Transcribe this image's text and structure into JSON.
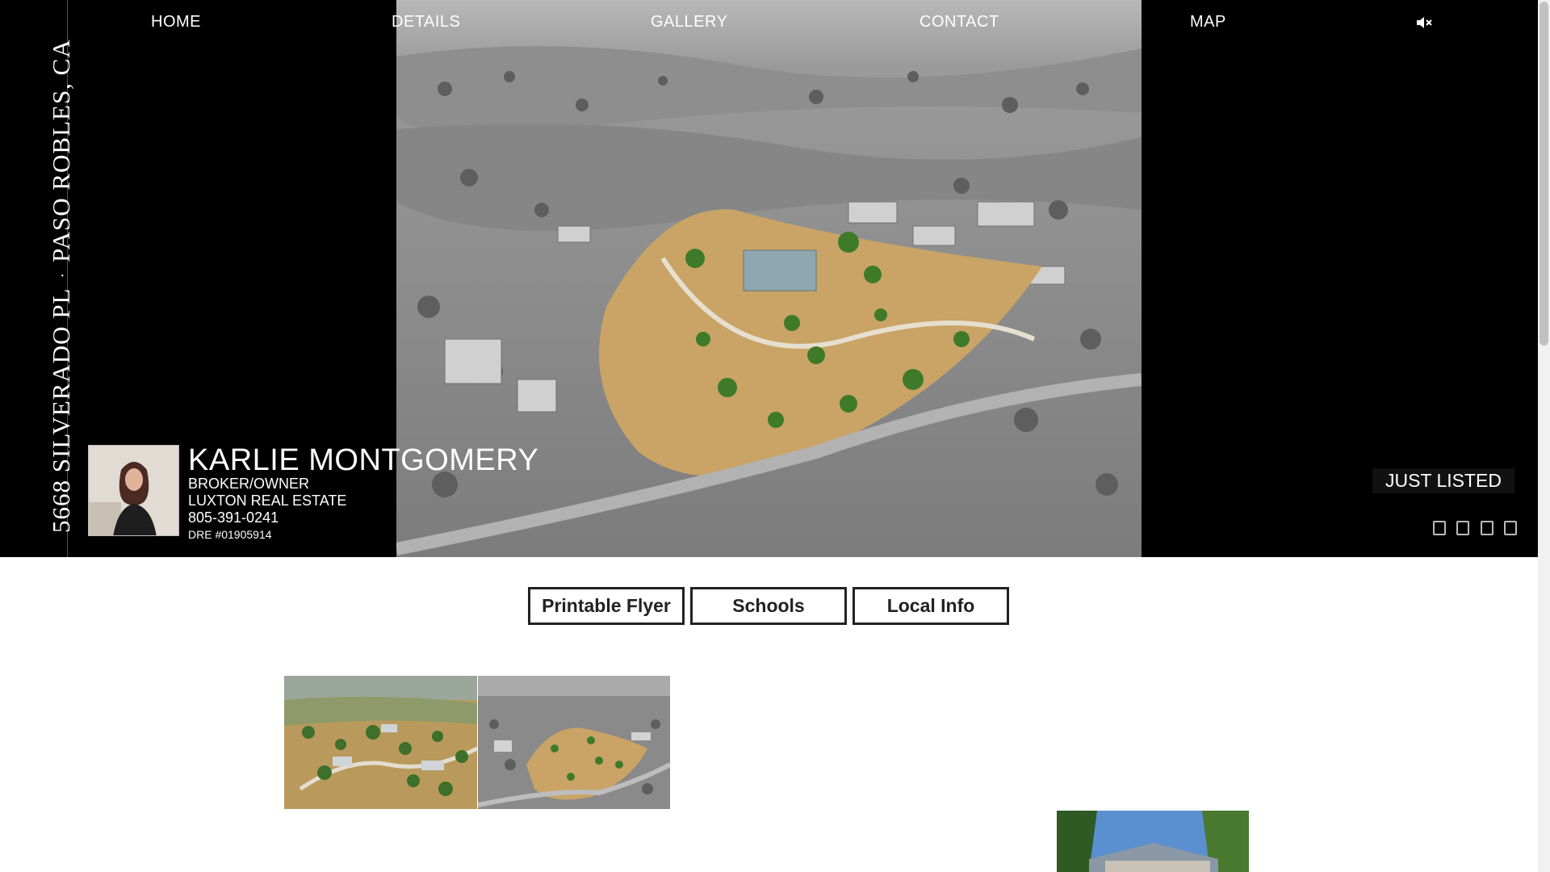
{
  "nav": {
    "items": [
      "HOME",
      "DETAILS",
      "GALLERY",
      "CONTACT",
      "MAP"
    ],
    "mute_icon": "volume-mute-icon"
  },
  "sidebar": {
    "street": "5668 SILVERADO PL",
    "separator": "·",
    "city": "PASO ROBLES, CA"
  },
  "agent": {
    "name": "KARLIE MONTGOMERY",
    "title": "BROKER/OWNER",
    "brokerage": "LUXTON REAL ESTATE",
    "phone": "805-391-0241",
    "dre": "DRE #01905914"
  },
  "status_badge": "JUST LISTED",
  "social_icons": [
    "facebook-icon",
    "twitter-icon",
    "pinterest-icon",
    "email-icon"
  ],
  "buttons": {
    "flyer": "Printable Flyer",
    "schools": "Schools",
    "local_info": "Local Info"
  },
  "colors": {
    "hero_bg": "#000000",
    "dry_grass": "#c9a466",
    "tree_green": "#3f7a2a"
  }
}
